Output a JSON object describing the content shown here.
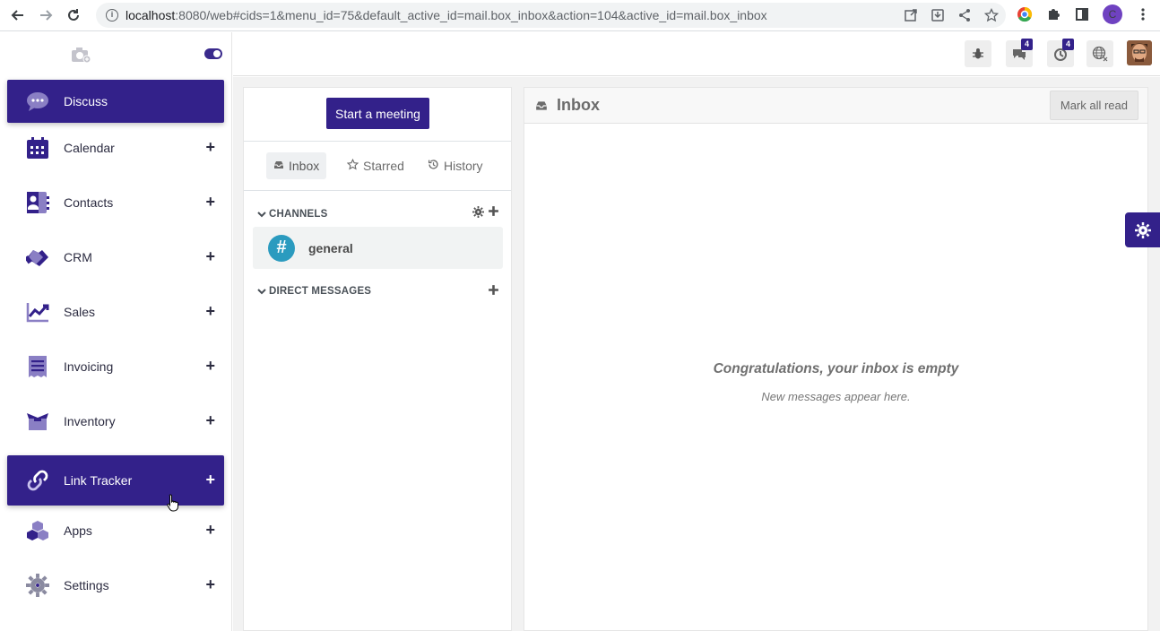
{
  "browser": {
    "url_host": "localhost",
    "url_rest": ":8080/web#cids=1&menu_id=75&default_active_id=mail.box_inbox&action=104&active_id=mail.box_inbox",
    "profile_initial": "C"
  },
  "sidebar": {
    "items": [
      {
        "label": "Discuss",
        "icon": "chat-bubbles-icon",
        "active": true,
        "plus": false
      },
      {
        "label": "Calendar",
        "icon": "calendar-icon",
        "active": false,
        "plus": true
      },
      {
        "label": "Contacts",
        "icon": "contact-card-icon",
        "active": false,
        "plus": true
      },
      {
        "label": "CRM",
        "icon": "handshake-icon",
        "active": false,
        "plus": true
      },
      {
        "label": "Sales",
        "icon": "trend-chart-icon",
        "active": false,
        "plus": true
      },
      {
        "label": "Invoicing",
        "icon": "receipt-icon",
        "active": false,
        "plus": true
      },
      {
        "label": "Inventory",
        "icon": "box-icon",
        "active": false,
        "plus": true
      },
      {
        "label": "Link Tracker",
        "icon": "link-icon",
        "active": true,
        "plus": true
      },
      {
        "label": "Apps",
        "icon": "cubes-icon",
        "active": false,
        "plus": true
      },
      {
        "label": "Settings",
        "icon": "gear-icon",
        "active": false,
        "plus": true
      }
    ],
    "plus_symbol": "+"
  },
  "topbar": {
    "messages_count": "4",
    "activities_count": "4"
  },
  "discuss": {
    "start_meeting": "Start a meeting",
    "tabs": [
      {
        "label": "Inbox",
        "active": true
      },
      {
        "label": "Starred",
        "active": false
      },
      {
        "label": "History",
        "active": false
      }
    ],
    "channels_header": "CHANNELS",
    "channels": [
      {
        "name": "general",
        "symbol": "#"
      }
    ],
    "dm_header": "DIRECT MESSAGES",
    "thread": {
      "title": "Inbox",
      "mark_all_read": "Mark all read",
      "empty_title": "Congratulations, your inbox is empty",
      "empty_subtitle": "New messages appear here."
    }
  },
  "colors": {
    "brand": "#33218a",
    "channel_avatar": "#2b9bbf"
  }
}
